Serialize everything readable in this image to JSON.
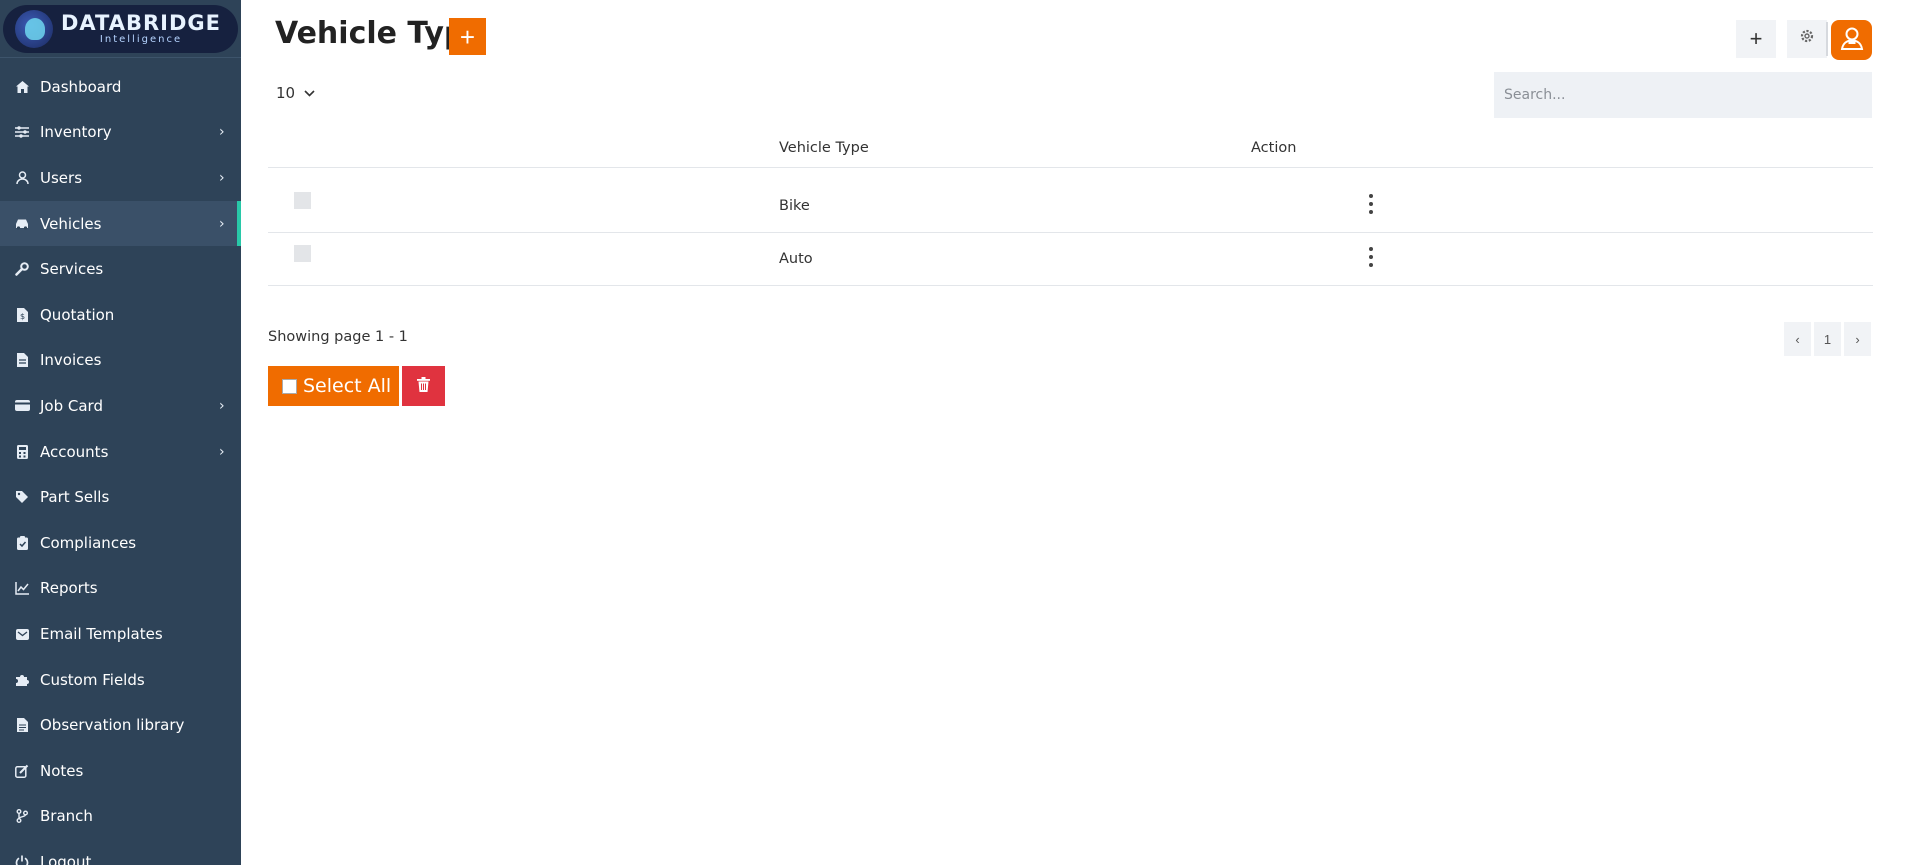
{
  "brand": {
    "name": "DATABRIDGE",
    "tagline": "Intelligence"
  },
  "sidebar": {
    "items": [
      {
        "label": "Dashboard",
        "icon": "home-icon",
        "has_submenu": false
      },
      {
        "label": "Inventory",
        "icon": "sliders-icon",
        "has_submenu": true
      },
      {
        "label": "Users",
        "icon": "user-icon",
        "has_submenu": true
      },
      {
        "label": "Vehicles",
        "icon": "car-icon",
        "has_submenu": true,
        "active": true
      },
      {
        "label": "Services",
        "icon": "wrench-icon",
        "has_submenu": false
      },
      {
        "label": "Quotation",
        "icon": "document-dollar-icon",
        "has_submenu": false
      },
      {
        "label": "Invoices",
        "icon": "document-icon",
        "has_submenu": false
      },
      {
        "label": "Job Card",
        "icon": "card-icon",
        "has_submenu": true
      },
      {
        "label": "Accounts",
        "icon": "calculator-icon",
        "has_submenu": true
      },
      {
        "label": "Part Sells",
        "icon": "tag-icon",
        "has_submenu": false
      },
      {
        "label": "Compliances",
        "icon": "clipboard-check-icon",
        "has_submenu": false
      },
      {
        "label": "Reports",
        "icon": "chart-line-icon",
        "has_submenu": false
      },
      {
        "label": "Email Templates",
        "icon": "email-icon",
        "has_submenu": false
      },
      {
        "label": "Custom Fields",
        "icon": "puzzle-icon",
        "has_submenu": false
      },
      {
        "label": "Observation library",
        "icon": "file-icon",
        "has_submenu": false
      },
      {
        "label": "Notes",
        "icon": "edit-icon",
        "has_submenu": false
      },
      {
        "label": "Branch",
        "icon": "branch-icon",
        "has_submenu": false
      },
      {
        "label": "Logout",
        "icon": "power-icon",
        "has_submenu": false
      }
    ]
  },
  "header": {
    "title": "Vehicle Type",
    "add_label": "+"
  },
  "toolbar": {
    "plus_label": "+",
    "settings_icon": "gear-icon",
    "avatar_icon": "user-avatar-icon"
  },
  "controls": {
    "page_size": "10",
    "search_placeholder": "Search..."
  },
  "table": {
    "columns": [
      "Vehicle Type",
      "Action"
    ],
    "rows": [
      {
        "vehicle_type": "Bike"
      },
      {
        "vehicle_type": "Auto"
      }
    ]
  },
  "footer": {
    "showing": "Showing page 1 - 1",
    "pager": {
      "prev": "‹",
      "page": "1",
      "next": "›"
    },
    "select_all_label": "Select All"
  },
  "colors": {
    "accent": "#f06c00",
    "danger": "#e0333f",
    "sidebar_bg": "#2e4358",
    "active_indicator": "#28c8a8"
  }
}
